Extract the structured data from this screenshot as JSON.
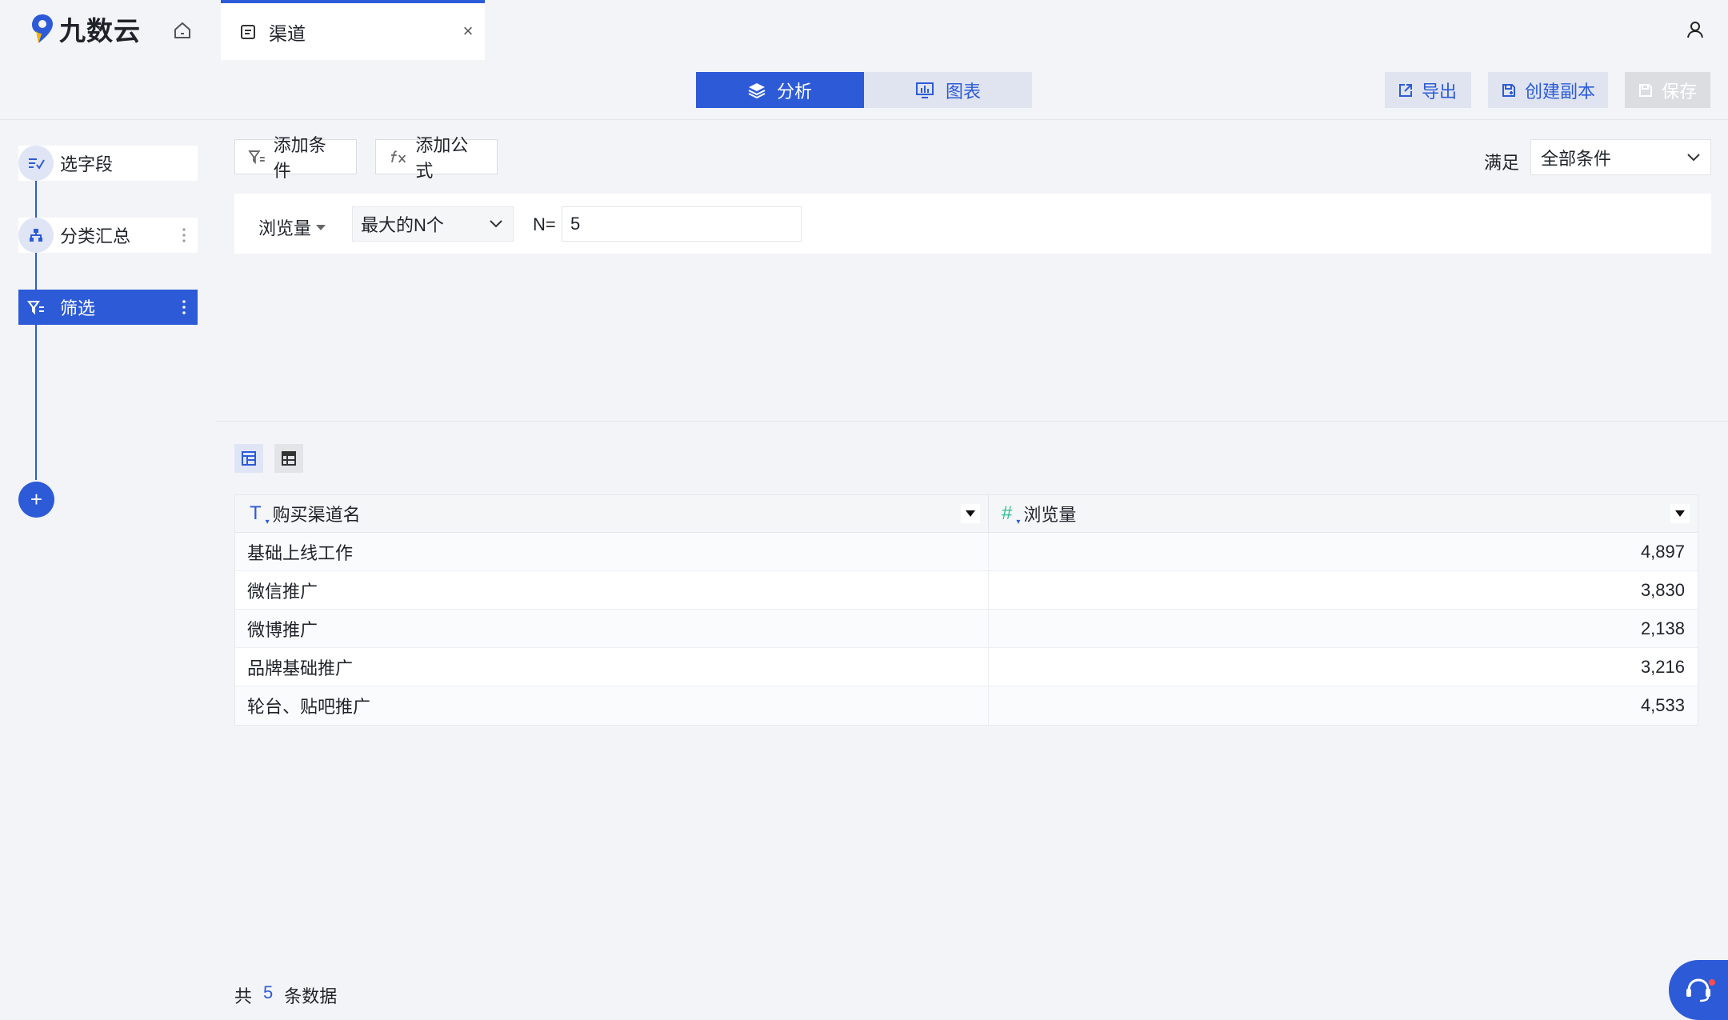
{
  "brand": {
    "name": "九数云",
    "accent": "#2d5bd7"
  },
  "tab": {
    "label": "渠道",
    "close": "×"
  },
  "toolbar": {
    "analysis": "分析",
    "chart": "图表",
    "export": "导出",
    "copy": "创建副本",
    "save": "保存"
  },
  "steps": [
    {
      "label": "选字段",
      "icon": "field-select-icon"
    },
    {
      "label": "分类汇总",
      "icon": "group-summary-icon"
    },
    {
      "label": "筛选",
      "icon": "filter-icon",
      "active": true
    }
  ],
  "step_add": "+",
  "filter": {
    "add_condition": "添加条件",
    "add_formula": "添加公式",
    "satisfy_label": "满足",
    "satisfy_value": "全部条件",
    "condition": {
      "field": "浏览量",
      "operator": "最大的N个",
      "n_label": "N=",
      "n_value": "5"
    }
  },
  "table": {
    "columns": [
      {
        "name": "购买渠道名",
        "type": "T"
      },
      {
        "name": "浏览量",
        "type": "#"
      }
    ],
    "rows": [
      [
        "基础上线工作",
        "4,897"
      ],
      [
        "微信推广",
        "3,830"
      ],
      [
        "微博推广",
        "2,138"
      ],
      [
        "品牌基础推广",
        "3,216"
      ],
      [
        "轮台、贴吧推广",
        "4,533"
      ]
    ]
  },
  "footer": {
    "prefix": "共",
    "count": "5",
    "suffix": "条数据"
  }
}
